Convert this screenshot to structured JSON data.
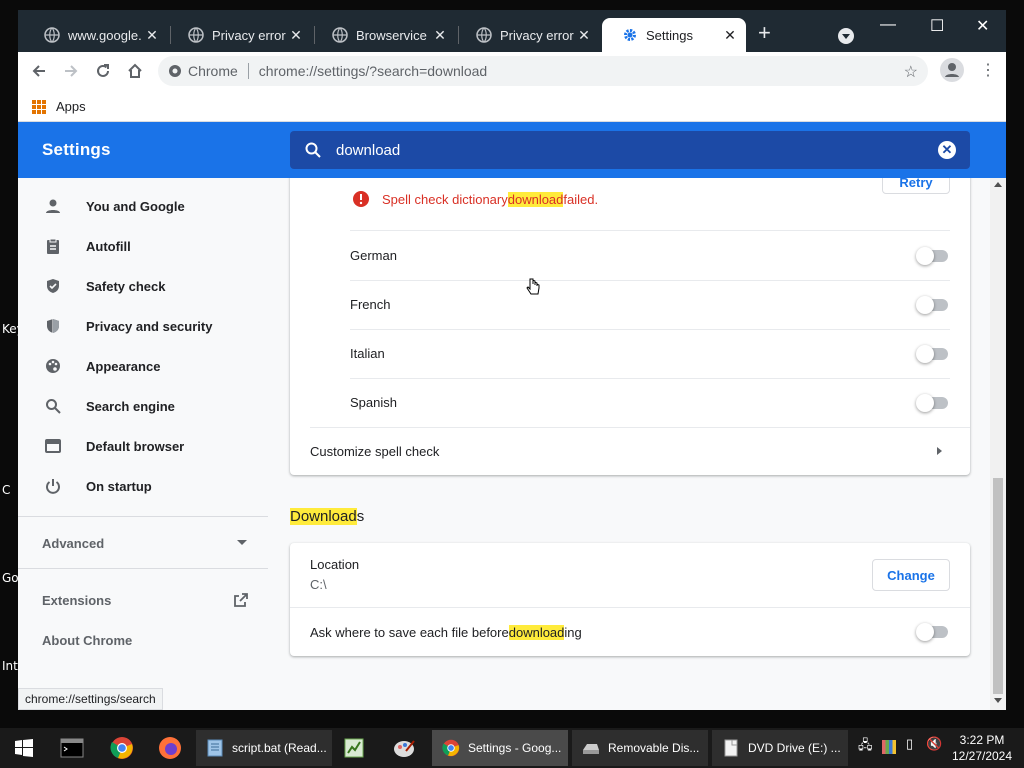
{
  "desktop": {
    "edge_labels": [
      "Key",
      "C",
      "Go",
      "Int"
    ]
  },
  "browser": {
    "tabs": [
      {
        "title": "www.google.co",
        "active": false
      },
      {
        "title": "Privacy error",
        "active": false
      },
      {
        "title": "Browservice",
        "active": false
      },
      {
        "title": "Privacy error",
        "active": false
      },
      {
        "title": "Settings",
        "active": true
      }
    ],
    "new_tab_symbol": "+",
    "window_controls": {
      "minimize": "—",
      "maximize": "☐",
      "close": "✕"
    },
    "omnibox": {
      "site": "Chrome",
      "url": "chrome://settings/?search=download"
    },
    "bookmarks": {
      "apps_label": "Apps"
    },
    "status_url": "chrome://settings/search"
  },
  "settings": {
    "title": "Settings",
    "search_value": "download",
    "sidebar": {
      "items": [
        {
          "label": "You and Google",
          "icon": "person-icon"
        },
        {
          "label": "Autofill",
          "icon": "clipboard-icon"
        },
        {
          "label": "Safety check",
          "icon": "shield-check-icon"
        },
        {
          "label": "Privacy and security",
          "icon": "shield-icon"
        },
        {
          "label": "Appearance",
          "icon": "palette-icon"
        },
        {
          "label": "Search engine",
          "icon": "search-icon"
        },
        {
          "label": "Default browser",
          "icon": "browser-icon"
        },
        {
          "label": "On startup",
          "icon": "power-icon"
        }
      ],
      "advanced": "Advanced",
      "extensions": "Extensions",
      "about": "About Chrome"
    },
    "spellcheck_card": {
      "retry_label": "Retry",
      "error_prefix": "Spell check dictionary ",
      "error_highlight": "download",
      "error_suffix": " failed.",
      "languages": [
        {
          "name": "German",
          "enabled": false
        },
        {
          "name": "French",
          "enabled": false
        },
        {
          "name": "Italian",
          "enabled": false
        },
        {
          "name": "Spanish",
          "enabled": false
        }
      ],
      "customize_label": "Customize spell check"
    },
    "downloads": {
      "heading_highlight": "Download",
      "heading_rest": "s",
      "location_label": "Location",
      "location_value": "C:\\",
      "change_label": "Change",
      "ask_prefix": "Ask where to save each file before ",
      "ask_highlight": "download",
      "ask_suffix": "ing",
      "ask_enabled": false
    }
  },
  "taskbar": {
    "tasks": [
      {
        "label": "script.bat (Read...",
        "icon": "notepad-icon",
        "active": false
      },
      {
        "label": "Settings - Goog...",
        "icon": "chrome-icon",
        "active": true
      },
      {
        "label": "Removable Dis...",
        "icon": "drive-icon",
        "active": false
      },
      {
        "label": "DVD Drive (E:) ...",
        "icon": "disc-icon",
        "active": false
      }
    ],
    "time": "3:22 PM",
    "date": "12/27/2024"
  },
  "colors": {
    "accent": "#1a73e8",
    "header_search_bg": "#1c4aa6",
    "highlight": "#ffeb3b",
    "error": "#d93025",
    "tabbar": "#1f2a33"
  }
}
